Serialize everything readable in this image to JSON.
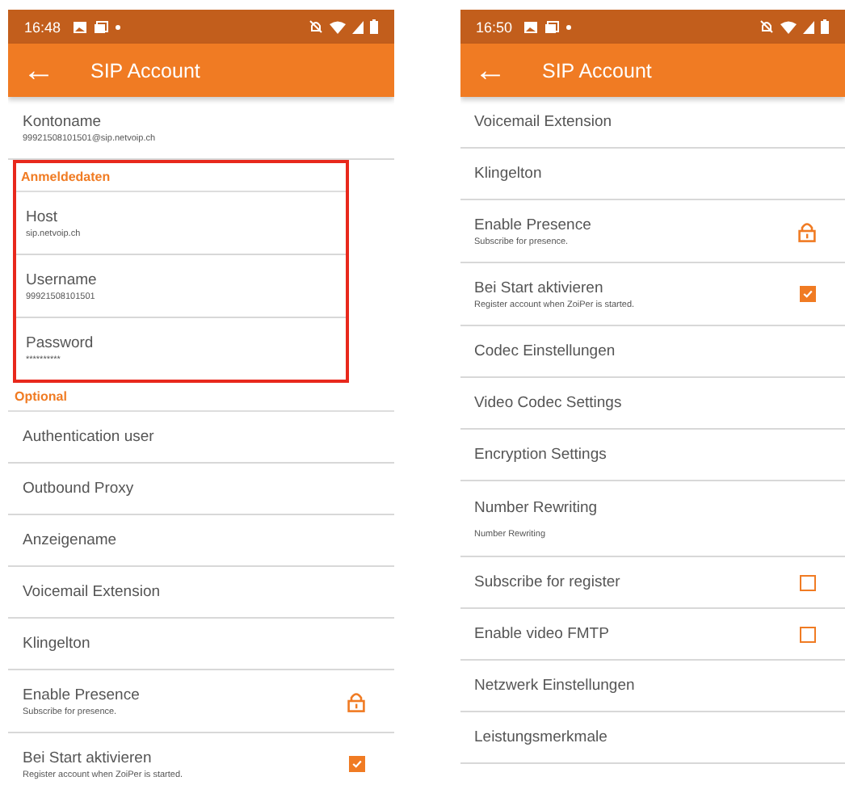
{
  "screens": [
    {
      "status_bar": {
        "time": "16:48"
      },
      "app_bar": {
        "back": "←",
        "title": "SIP Account"
      },
      "sections": [
        {
          "highlighted": false,
          "items": [
            {
              "title": "Kontoname",
              "subtitle": "99921508101501@sip.netvoip.ch",
              "kind": "plain"
            }
          ]
        },
        {
          "header": "Anmeldedaten",
          "highlighted": true,
          "items": [
            {
              "title": "Host",
              "subtitle": "sip.netvoip.ch",
              "kind": "plain"
            },
            {
              "title": "Username",
              "subtitle": "99921508101501",
              "kind": "plain"
            },
            {
              "title": "Password",
              "subtitle": "**********",
              "kind": "plain"
            }
          ]
        },
        {
          "header": "Optional",
          "highlighted": false,
          "items": [
            {
              "title": "Authentication user",
              "kind": "plain"
            },
            {
              "title": "Outbound Proxy",
              "kind": "plain"
            },
            {
              "title": "Anzeigename",
              "kind": "plain"
            },
            {
              "title": "Voicemail Extension",
              "kind": "plain"
            },
            {
              "title": "Klingelton",
              "kind": "plain"
            },
            {
              "title": "Enable Presence",
              "subtitle": "Subscribe for presence.",
              "kind": "lock"
            },
            {
              "title": "Bei Start aktivieren",
              "subtitle": "Register account when ZoiPer is started.",
              "kind": "checkbox",
              "checked": true
            }
          ]
        }
      ]
    },
    {
      "status_bar": {
        "time": "16:50"
      },
      "app_bar": {
        "back": "←",
        "title": "SIP Account"
      },
      "sections": [
        {
          "highlighted": false,
          "items": [
            {
              "title": "Voicemail Extension",
              "kind": "plain"
            },
            {
              "title": "Klingelton",
              "kind": "plain"
            },
            {
              "title": "Enable Presence",
              "subtitle": "Subscribe for presence.",
              "kind": "lock"
            },
            {
              "title": "Bei Start aktivieren",
              "subtitle": "Register account when ZoiPer is started.",
              "kind": "checkbox",
              "checked": true
            },
            {
              "title": "Codec Einstellungen",
              "kind": "plain"
            },
            {
              "title": "Video Codec Settings",
              "kind": "plain"
            },
            {
              "title": "Encryption Settings",
              "kind": "plain"
            },
            {
              "title": "Number Rewriting",
              "subtitle": "Number Rewriting",
              "kind": "plain",
              "tall": true
            },
            {
              "title": "Subscribe for register",
              "kind": "checkbox",
              "checked": false
            },
            {
              "title": "Enable video FMTP",
              "kind": "checkbox",
              "checked": false
            },
            {
              "title": "Netzwerk Einstellungen",
              "kind": "plain"
            },
            {
              "title": "Leistungsmerkmale",
              "kind": "plain"
            }
          ]
        }
      ]
    }
  ]
}
